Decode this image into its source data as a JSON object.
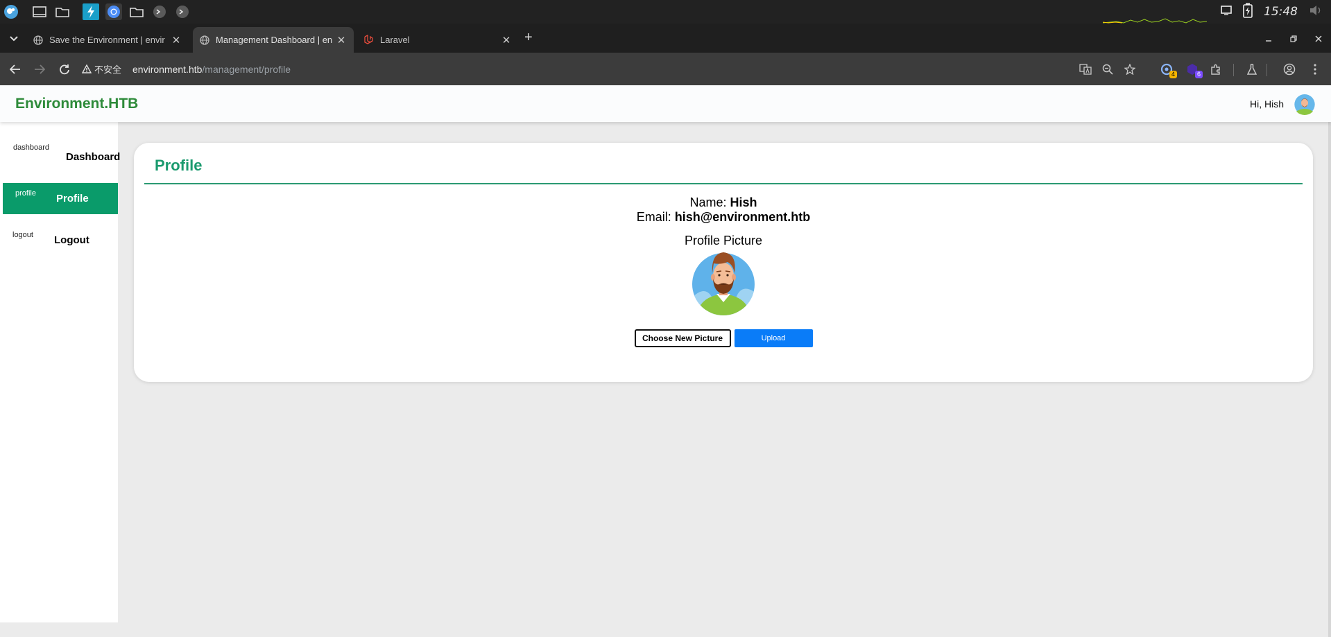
{
  "taskbar": {
    "clock": "15:48",
    "apps": [
      "app-launcher-icon",
      "desktop-icon",
      "file-manager-icon",
      "power-tool-icon",
      "chromium-icon",
      "folder-icon",
      "terminal-icon",
      "terminal-icon"
    ]
  },
  "browser": {
    "tabs": [
      {
        "title": "Save the Environment | envir",
        "icon": "globe-icon",
        "active": false
      },
      {
        "title": "Management Dashboard | en",
        "icon": "globe-icon",
        "active": true
      },
      {
        "title": "Laravel",
        "icon": "laravel-icon",
        "active": false
      }
    ],
    "tab_close": "✕",
    "new_tab": "+",
    "security_label": "不安全",
    "url_host": "environment.htb",
    "url_path": "/management/profile",
    "extensions": [
      {
        "icon": "extension-a-icon",
        "badge": "4",
        "badge_color": "#f4b400"
      },
      {
        "icon": "extension-b-icon",
        "badge": "6",
        "badge_color": "#7c4dff"
      }
    ]
  },
  "site": {
    "brand": "Environment.HTB",
    "greeting": "Hi, Hish",
    "colors": {
      "brand": "#2e8b3a",
      "accent": "#0a9b6a",
      "upload": "#0a7cf8"
    }
  },
  "sidebar": {
    "items": [
      {
        "alt": "dashboard",
        "label": "Dashboard",
        "active": false
      },
      {
        "alt": "profile",
        "label": "Profile",
        "active": true
      },
      {
        "alt": "logout",
        "label": "Logout",
        "active": false
      }
    ]
  },
  "profile": {
    "title": "Profile",
    "name_label": "Name:",
    "name_value": "Hish",
    "email_label": "Email:",
    "email_value": "hish@environment.htb",
    "picture_heading": "Profile Picture",
    "choose_label": "Choose New Picture",
    "upload_label": "Upload"
  }
}
